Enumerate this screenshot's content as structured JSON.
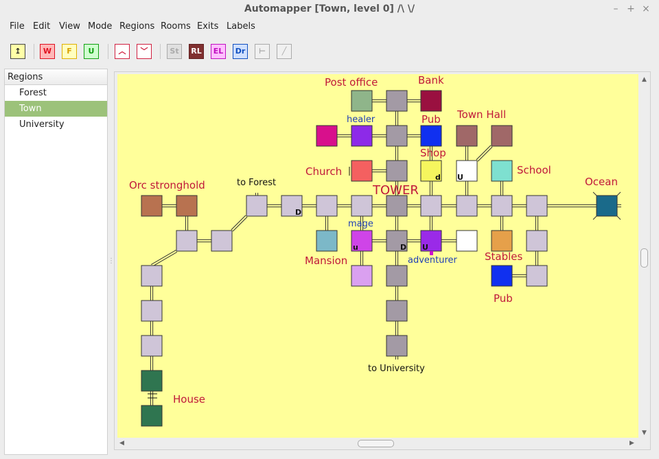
{
  "window": {
    "title": "Automapper [Town, level 0] /\\ \\/",
    "minimize": "–",
    "maximize": "+",
    "close": "×"
  },
  "menu": [
    "File",
    "Edit",
    "View",
    "Mode",
    "Regions",
    "Rooms",
    "Exits",
    "Labels"
  ],
  "toolbar": [
    {
      "id": "anchor",
      "label": "↥",
      "fg": "#222",
      "bg": "#ffffa8",
      "border": "#444"
    },
    {
      "id": "w",
      "label": "W",
      "fg": "#e01020",
      "bg": "#ffb8b8",
      "border": "#e01020"
    },
    {
      "id": "f",
      "label": "F",
      "fg": "#d8a000",
      "bg": "#ffffc0",
      "border": "#e0b000"
    },
    {
      "id": "u",
      "label": "U",
      "fg": "#10a010",
      "bg": "#d0ffd0",
      "border": "#10a010"
    },
    {
      "id": "up",
      "label": "︿",
      "fg": "#d02040",
      "bg": "#ffffff",
      "border": "#d02040"
    },
    {
      "id": "down",
      "label": "﹀",
      "fg": "#d02040",
      "bg": "#ffffff",
      "border": "#d02040"
    },
    {
      "id": "st",
      "label": "St",
      "fg": "#aaaaaa",
      "bg": "#e0e0e0",
      "border": "#aaaaaa"
    },
    {
      "id": "rl",
      "label": "RL",
      "fg": "#ffffff",
      "bg": "#803030",
      "border": "#602020"
    },
    {
      "id": "el",
      "label": "EL",
      "fg": "#c010c0",
      "bg": "#ffc0ff",
      "border": "#c010c0"
    },
    {
      "id": "dr",
      "label": "Dr",
      "fg": "#1050c0",
      "bg": "#d0e0ff",
      "border": "#1050c0"
    },
    {
      "id": "pin",
      "label": "⊢",
      "fg": "#aaaaaa",
      "bg": "#f0f0f0",
      "border": "#aaaaaa"
    },
    {
      "id": "line",
      "label": "╱",
      "fg": "#aaaaaa",
      "bg": "#f0f0f0",
      "border": "#aaaaaa"
    }
  ],
  "sidebar": {
    "header": "Regions",
    "items": [
      {
        "label": "Forest",
        "selected": false
      },
      {
        "label": "Town",
        "selected": true
      },
      {
        "label": "University",
        "selected": false
      }
    ]
  },
  "map": {
    "labels": {
      "post_office": "Post office",
      "bank": "Bank",
      "healer": "healer",
      "pub_north": "Pub",
      "town_hall": "Town Hall",
      "shop": "Shop",
      "church": "Church",
      "school": "School",
      "tower": "TOWER",
      "orc_stronghold": "Orc stronghold",
      "to_forest": "to Forest",
      "ocean": "Ocean",
      "mage": "mage",
      "mansion": "Mansion",
      "adventurer": "adventurer",
      "stables": "Stables",
      "pub_south": "Pub",
      "house": "House",
      "to_university": "to University"
    },
    "room_marks": {
      "d1": "D",
      "d2": "d",
      "u1": "U",
      "u2": "u",
      "d3": "D",
      "u3": "U"
    },
    "colors": {
      "plain": "#cfc5d8",
      "tower": "#a39aa5",
      "orc": "#b87250",
      "post_office": "#8fb58a",
      "bank": "#9a1040",
      "magenta": "#d8108c",
      "violet": "#8d2ae8",
      "blue": "#1030f0",
      "brown_hall": "#a06868",
      "church": "#f46060",
      "shop": "#f6f65e",
      "white": "#ffffff",
      "school": "#7ee0d0",
      "ocean": "#1a6a8a",
      "mage": "#cf44e8",
      "mansion": "#7cb8c8",
      "adventurer": "#9a2ae8",
      "stables": "#e6a04a",
      "lilac": "#daa0f0",
      "house": "#2f7550"
    }
  }
}
